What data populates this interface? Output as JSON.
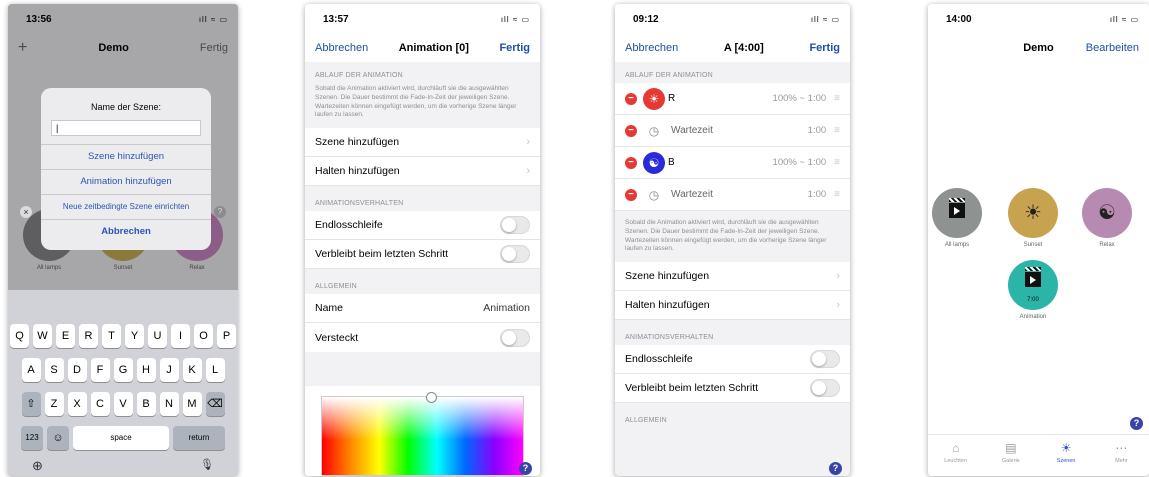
{
  "phone1": {
    "status": {
      "time": "13:56",
      "signal": "ıll ≈ ▭"
    },
    "nav": {
      "left": "+",
      "title": "Demo",
      "right": "Fertig"
    },
    "dialog": {
      "title": "Name der Szene:",
      "input_value": "|",
      "buttons": [
        "Szene hinzufügen",
        "Animation hinzufügen",
        "Neue zeitbedingte Szene einrichten",
        "Abbrechen"
      ]
    },
    "scenes": [
      {
        "label": "All lamps",
        "color": "#5e5e60"
      },
      {
        "label": "Sunset",
        "color": "#8a7a3e"
      },
      {
        "label": "Relax",
        "color": "#8a5e86"
      }
    ],
    "badges": {
      "close": "×",
      "help": "?"
    },
    "keyboard": {
      "row1": [
        "Q",
        "W",
        "E",
        "R",
        "T",
        "Y",
        "U",
        "I",
        "O",
        "P"
      ],
      "row2": [
        "A",
        "S",
        "D",
        "F",
        "G",
        "H",
        "J",
        "K",
        "L"
      ],
      "row3": [
        "⇧",
        "Z",
        "X",
        "C",
        "V",
        "B",
        "N",
        "M",
        "⌫"
      ],
      "row4": {
        "num": "123",
        "emoji": "☺",
        "space": "space",
        "return": "return"
      },
      "globe": "⊕",
      "mic": "🎙"
    }
  },
  "phone2": {
    "status": {
      "time": "13:57",
      "signal": "ıll ≈ ▭"
    },
    "nav": {
      "left": "Abbrechen",
      "title": "Animation [0]",
      "right": "Fertig"
    },
    "section1": {
      "header": "ABLAUF DER ANIMATION",
      "text": "Sobald die Animation aktiviert wird, durchläuft sie die ausgewählten Szenen. Die Dauer bestimmt die Fade-In-Zeit der jeweiligen Szene. Wartezeiten können eingefügt werden, um die vorherige Szene länger laufen zu lassen."
    },
    "add_scene": "Szene hinzufügen",
    "add_hold": "Halten hinzufügen",
    "section2": {
      "header": "ANIMATIONSVERHALTEN"
    },
    "endless": "Endlosschleife",
    "stay_last": "Verbleibt beim letzten Schritt",
    "section3": {
      "header": "ALLGEMEIN"
    },
    "name_label": "Name",
    "name_value": "Animation",
    "hidden_label": "Versteckt",
    "help": "?"
  },
  "phone3": {
    "status": {
      "time": "09:12",
      "signal": "ıll ≈ ▭"
    },
    "nav": {
      "left": "Abbrechen",
      "title": "A [4:00]",
      "right": "Fertig"
    },
    "section1": {
      "header": "ABLAUF DER ANIMATION"
    },
    "steps": [
      {
        "name": "R",
        "value": "100% ~ 1:00",
        "icon": "☀",
        "color": "#e53935"
      },
      {
        "name": "Wartezeit",
        "value": "1:00",
        "icon": "◷",
        "color": ""
      },
      {
        "name": "B",
        "value": "100% ~ 1:00",
        "icon": "☯",
        "color": "#2a2ad8"
      },
      {
        "name": "Wartezeit",
        "value": "1:00",
        "icon": "◷",
        "color": ""
      }
    ],
    "minus": "−",
    "drag": "≡",
    "text": "Sobald die Animation aktiviert wird, durchläuft sie die ausgewählten Szenen. Die Dauer bestimmt die Fade-In-Zeit der jeweiligen Szene. Wartezeiten können eingefügt werden, um die vorherige Szene länger laufen zu lassen.",
    "add_scene": "Szene hinzufügen",
    "add_hold": "Halten hinzufügen",
    "section2": {
      "header": "ANIMATIONSVERHALTEN"
    },
    "endless": "Endlosschleife",
    "stay_last": "Verbleibt beim letzten Schritt",
    "section3": {
      "header": "ALLGEMEIN"
    },
    "help": "?"
  },
  "phone4": {
    "status": {
      "time": "14:00",
      "signal": "ıll ≈ ▭"
    },
    "nav": {
      "title": "Demo",
      "right": "Bearbeiten"
    },
    "scenes": [
      {
        "label": "All lamps",
        "color": "#8e9290",
        "icon": ""
      },
      {
        "label": "Sunset",
        "color": "#c8a34f",
        "icon": "☀"
      },
      {
        "label": "Relax",
        "color": "#b78ab2",
        "icon": "☯"
      },
      {
        "label": "Animation",
        "color": "#2bb5a9",
        "icon": "",
        "time": "7:00"
      }
    ],
    "help": "?",
    "tabs": [
      {
        "label": "Leuchten",
        "icon": "⌂"
      },
      {
        "label": "Galerie",
        "icon": "▤"
      },
      {
        "label": "Szenen",
        "icon": "☀"
      },
      {
        "label": "Mehr",
        "icon": "⋯"
      }
    ],
    "accent": "#2f53c9"
  }
}
